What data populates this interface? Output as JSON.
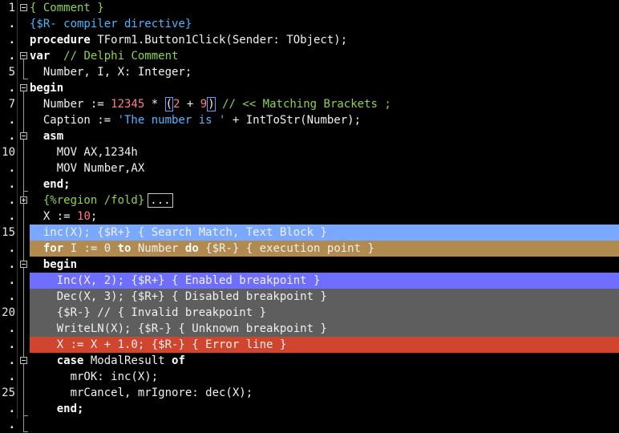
{
  "editor": {
    "line_numbers": [
      "1",
      ".",
      ".",
      ".",
      "5",
      ".",
      "7",
      ".",
      ".",
      "10",
      ".",
      ".",
      ".",
      ".",
      "15",
      ".",
      ".",
      ".",
      ".",
      "20",
      ".",
      ".",
      ".",
      ".",
      "25",
      ".",
      "."
    ],
    "fold_marker_text": "...",
    "colors": {
      "background": "#000000",
      "keyword": "#ffffff",
      "comment": "#8fd14f",
      "directive": "#4fb3ff",
      "number": "#ff7b8a",
      "string": "#5bb4ff",
      "current_line": "#000000",
      "search_match": "#7aa8ff",
      "execution_point": "#b08a4e",
      "enabled_breakpoint": "#6e6eff",
      "disabled_breakpoint": "#5e5e5e",
      "error_line": "#d0452e"
    },
    "lines": [
      [
        {
          "t": "{ Comment }",
          "c": "cm"
        }
      ],
      [
        {
          "t": "{$R- compiler directive}",
          "c": "dir"
        }
      ],
      [
        {
          "t": "procedure",
          "c": "kw"
        },
        {
          "t": " TForm1.Button1Click(Sender: TObject);",
          "c": ""
        }
      ],
      [
        {
          "t": "var",
          "c": "kw"
        },
        {
          "t": "  ",
          "c": ""
        },
        {
          "t": "// Delphi Comment",
          "c": "cm"
        }
      ],
      [
        {
          "t": "  Number, I, X: Integer;",
          "c": ""
        }
      ],
      [
        {
          "t": "begin",
          "c": "kw"
        }
      ],
      [
        {
          "t": "  Number := ",
          "c": ""
        },
        {
          "t": "12345",
          "c": "num"
        },
        {
          "t": " * ",
          "c": ""
        },
        {
          "t": "(",
          "c": "bracket"
        },
        {
          "t": "2",
          "c": "num"
        },
        {
          "t": " + ",
          "c": ""
        },
        {
          "t": "9",
          "c": "num"
        },
        {
          "t": ")",
          "c": "bracket"
        },
        {
          "t": " ",
          "c": ""
        },
        {
          "t": "// << Matching Brackets ;",
          "c": "cm"
        }
      ],
      [
        {
          "t": "  Caption := ",
          "c": ""
        },
        {
          "t": "'The number is '",
          "c": "str"
        },
        {
          "t": " + IntToStr(Number);",
          "c": ""
        }
      ],
      [
        {
          "t": "  asm",
          "c": "kw"
        }
      ],
      [
        {
          "t": "    MOV AX,1234h",
          "c": ""
        }
      ],
      [
        {
          "t": "    MOV Number,AX",
          "c": ""
        }
      ],
      [
        {
          "t": "  end;",
          "c": "kw"
        }
      ],
      [
        {
          "t": "  {%region /fold}",
          "c": "cm"
        }
      ],
      [
        {
          "t": "  X := ",
          "c": ""
        },
        {
          "t": "10",
          "c": "num"
        },
        {
          "t": ";",
          "c": ""
        }
      ],
      [
        {
          "t": "  inc(X); {$R+} { Search Match, Text Block }",
          "c": ""
        }
      ],
      [
        {
          "t": "  ",
          "c": ""
        },
        {
          "t": "for",
          "c": "kw"
        },
        {
          "t": " I := 0 ",
          "c": ""
        },
        {
          "t": "to",
          "c": "kw"
        },
        {
          "t": " Number ",
          "c": ""
        },
        {
          "t": "do",
          "c": "kw"
        },
        {
          "t": " {$R-} { execution point }",
          "c": ""
        }
      ],
      [
        {
          "t": "  begin",
          "c": "kw"
        }
      ],
      [
        {
          "t": "    Inc(X, 2); {$R+} { Enabled breakpoint }",
          "c": ""
        }
      ],
      [
        {
          "t": "    Dec(X, 3); {$R+} { Disabled breakpoint }",
          "c": ""
        }
      ],
      [
        {
          "t": "    {$R-} // { Invalid breakpoint }",
          "c": ""
        }
      ],
      [
        {
          "t": "    WriteLN(X); {$R-} { Unknown breakpoint }",
          "c": ""
        }
      ],
      [
        {
          "t": "    X := X + 1.0; {$R-} { Error line }",
          "c": ""
        }
      ],
      [
        {
          "t": "    case",
          "c": "kw"
        },
        {
          "t": " ModalResult ",
          "c": ""
        },
        {
          "t": "of",
          "c": "kw"
        }
      ],
      [
        {
          "t": "      mrOK: inc(X);",
          "c": ""
        }
      ],
      [
        {
          "t": "      mrCancel, mrIgnore: dec(X);",
          "c": ""
        }
      ],
      [
        {
          "t": "    end;",
          "c": "kw"
        }
      ],
      [
        {
          "t": "",
          "c": ""
        }
      ]
    ],
    "line_backgrounds": [
      "",
      "",
      "",
      "",
      "",
      "",
      "current_line",
      "",
      "",
      "",
      "",
      "",
      "",
      "",
      "search_match",
      "execution_point",
      "",
      "enabled_breakpoint",
      "disabled_breakpoint",
      "disabled_breakpoint",
      "disabled_breakpoint",
      "error_line",
      "",
      "",
      "",
      "",
      ""
    ],
    "fold_boxes": [
      {
        "line": 0,
        "type": "minus"
      },
      {
        "line": 3,
        "type": "minus"
      },
      {
        "line": 5,
        "type": "minus"
      },
      {
        "line": 8,
        "type": "minus"
      },
      {
        "line": 12,
        "type": "plus"
      },
      {
        "line": 16,
        "type": "minus"
      },
      {
        "line": 22,
        "type": "minus"
      }
    ]
  }
}
